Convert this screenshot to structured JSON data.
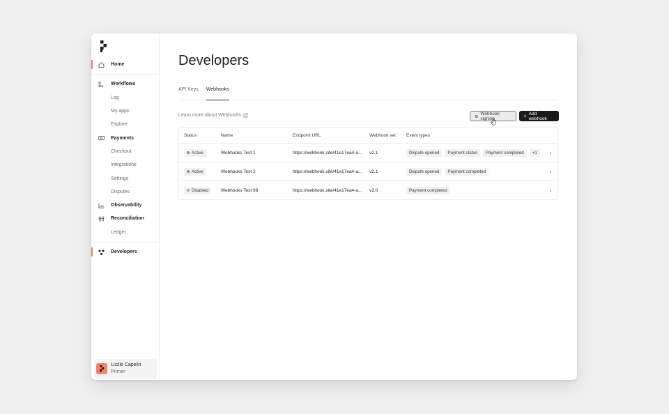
{
  "sidebar": {
    "items": [
      {
        "label": "Home",
        "icon": "home-icon",
        "type": "primary",
        "active": true
      },
      {
        "label": "Workflows",
        "icon": "workflow-icon",
        "type": "primary"
      },
      {
        "label": "Log",
        "type": "sub"
      },
      {
        "label": "My apps",
        "type": "sub"
      },
      {
        "label": "Explore",
        "type": "sub"
      },
      {
        "label": "Payments",
        "icon": "payments-icon",
        "type": "primary"
      },
      {
        "label": "Checkout",
        "type": "sub"
      },
      {
        "label": "Integrations",
        "type": "sub"
      },
      {
        "label": "Settings",
        "type": "sub"
      },
      {
        "label": "Disputes",
        "type": "sub"
      },
      {
        "label": "Observability",
        "icon": "chart-icon",
        "type": "primary"
      },
      {
        "label": "Reconciliation",
        "icon": "reconciliation-icon",
        "type": "primary"
      },
      {
        "label": "Ledger",
        "type": "sub"
      },
      {
        "label": "Developers",
        "icon": "developers-icon",
        "type": "primary",
        "active": true
      }
    ],
    "user": {
      "name": "Lizzie Capelin",
      "org": "Primer"
    }
  },
  "main": {
    "title": "Developers",
    "tabs": [
      {
        "label": "API Keys",
        "active": false
      },
      {
        "label": "Webhooks",
        "active": true
      }
    ],
    "learn_more": "Learn more about Webhooks",
    "signing_button": "Webhook signing",
    "add_button": "Add webhook",
    "table": {
      "headers": [
        "Status",
        "Name",
        "Endpoint URL",
        "Webhook ver.",
        "Event types"
      ],
      "rows": [
        {
          "status": "Active",
          "name": "Webhooks Test 1",
          "url": "https://webhook.site/41e17ea4-a...",
          "version": "v2.1",
          "events": [
            "Dispute opened",
            "Payment status",
            "Payment completed",
            "+1"
          ]
        },
        {
          "status": "Active",
          "name": "Webhooks Test 2",
          "url": "https://webhook.site/41e17ea4-a...",
          "version": "v2.1",
          "events": [
            "Dispute opened",
            "Payment completed"
          ]
        },
        {
          "status": "Disabled",
          "name": "Webhooks Test 99",
          "url": "https://webhook.site/41e17ea4-a...",
          "version": "v2.0",
          "events": [
            "Payment completed"
          ]
        }
      ]
    }
  },
  "colors": {
    "accent": "#f0826e",
    "button_dark": "#1a1a1a"
  }
}
